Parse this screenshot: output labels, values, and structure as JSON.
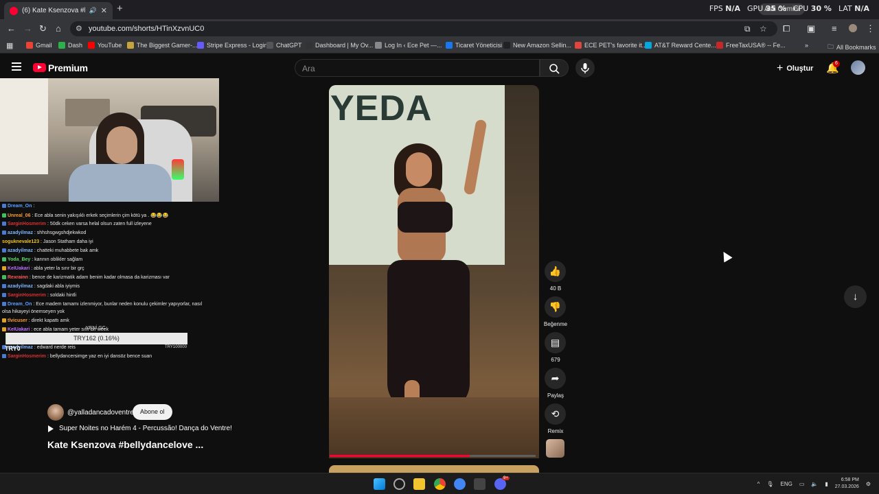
{
  "browser": {
    "tab_title": "(6) Kate Ksenzova #bellyda",
    "tab_audio_icon": "speaker-icon",
    "new_tab_glyph": "+",
    "gemini_label": "Ask Gemini",
    "url": "youtube.com/shorts/HTinXzvnUC0",
    "perf": {
      "fps_label": "FPS",
      "fps_value": "N/A",
      "gpu_label": "GPU",
      "gpu_value": "35 %",
      "cpu_label": "CPU",
      "cpu_value": "30 %",
      "lat_label": "LAT",
      "lat_value": "N/A"
    },
    "bookmarks": [
      {
        "label": "Gmail",
        "icon": "gmail-icon",
        "color": "#ea4335"
      },
      {
        "label": "Dash",
        "icon": "dash-icon",
        "color": "#2bb34a"
      },
      {
        "label": "YouTube",
        "icon": "youtube-icon",
        "color": "#ff0000"
      },
      {
        "label": "The Biggest Gamer-...",
        "icon": "gamer-icon",
        "color": "#c8a33b"
      },
      {
        "label": "Stripe Express - Login",
        "icon": "stripe-icon",
        "color": "#635bff"
      },
      {
        "label": "ChatGPT",
        "icon": "chatgpt-icon",
        "color": "#555555"
      },
      {
        "label": "Dashboard | My Ov...",
        "icon": "dashboard-icon",
        "color": "#333333"
      },
      {
        "label": "Log In ‹ Ece Pet —...",
        "icon": "wordpress-icon",
        "color": "#888888"
      },
      {
        "label": "Ticaret Yöneticisi",
        "icon": "meta-icon",
        "color": "#1877f2"
      },
      {
        "label": "New Amazon Sellin...",
        "icon": "amazon-icon",
        "color": "#222222"
      },
      {
        "label": "ECE PET's favorite it...",
        "icon": "shop-icon",
        "color": "#e0463c"
      },
      {
        "label": "AT&T Reward Cente...",
        "icon": "att-icon",
        "color": "#00a8e0"
      },
      {
        "label": "FreeTaxUSA® -- Fe...",
        "icon": "tax-icon",
        "color": "#c62828"
      }
    ],
    "all_bookmarks": "All Bookmarks"
  },
  "youtube": {
    "brand": "Premium",
    "search_placeholder": "Ara",
    "create_label": "Oluştur",
    "notification_count": "6"
  },
  "chat": [
    {
      "user": "Dream_On",
      "user_color": "#5aa0ff",
      "text": ":",
      "badge": "#4a7bd0"
    },
    {
      "user": "Unreal_06",
      "user_color": "#ff9e2c",
      "text": ": Ece abla senin yakışıklı erkek seçimlerin çim kötü ya . 😂😂😂",
      "badge": "#3cc060"
    },
    {
      "user": "SarginHosmerim",
      "user_color": "#d93030",
      "text": ": 50dk ceken varsa helal olsun zaten full izleyene",
      "badge": "#4a7bd0"
    },
    {
      "user": "azadyilmaz",
      "user_color": "#7db6ff",
      "text": ": shhshsgwgshdjekwkod",
      "badge": "#4a7bd0"
    },
    {
      "user": "soguknevale123",
      "user_color": "#f1c40f",
      "text": ": Jason Statham daha iyi",
      "badge": ""
    },
    {
      "user": "azadyilmaz",
      "user_color": "#7db6ff",
      "text": ": chatteki muhabbete bak amk",
      "badge": "#4a7bd0"
    },
    {
      "user": "Yoda_Bey",
      "user_color": "#55d96b",
      "text": ": karının oblikler sağlam",
      "badge": "#3cc060"
    },
    {
      "user": "KeIUakari",
      "user_color": "#c070ff",
      "text": ": abla yeter la sırır bir grç",
      "badge": "#e0a020"
    },
    {
      "user": "Rexrainn",
      "user_color": "#ff5a5a",
      "text": ": bence de karizmatik adam benim kadar olmasa da karizması var",
      "badge": "#3cc060"
    },
    {
      "user": "azadyilmaz",
      "user_color": "#7db6ff",
      "text": ": sagdaki abla iyiymis",
      "badge": "#4a7bd0"
    },
    {
      "user": "SarginHosmerim",
      "user_color": "#d93030",
      "text": ": soldaki hintli",
      "badge": "#4a7bd0"
    },
    {
      "user": "Dream_On",
      "user_color": "#5aa0ff",
      "text": ": Ece madem tamamı izlenmiyor, bunlar neden konulu çekimler yapıyorlar, nasıl",
      "badge": "#4a7bd0"
    },
    {
      "user": "",
      "user_color": "#e8e8e8",
      "text": "olsa hikayeyi önemseyen yok",
      "badge": ""
    },
    {
      "user": "tlvicuser",
      "user_color": "#ff9e2c",
      "text": ": direkt kapattı amk",
      "badge": "#e0a020"
    },
    {
      "user": "KeIUakari",
      "user_color": "#c070ff",
      "text": ": ece abla tamam yeter sıfır bir week",
      "badge": "#e0a020"
    },
    {
      "user": "azadyilmaz",
      "user_color": "#7db6ff",
      "text": ": edward nerde reis",
      "badge": "#4a7bd0"
    },
    {
      "user": "SarginHosmerim",
      "user_color": "#d93030",
      "text": ": bellydancersimge yaz en iyi dansöz bence suan",
      "badge": "#4a7bd0"
    }
  ],
  "donation": {
    "header": "YENİ GC",
    "bar_text": "TRY162 (0.16%)",
    "left": "TRY0",
    "right": "TRY100000",
    "progress": 0.16
  },
  "short": {
    "banner_text": "YEDA",
    "channel": "@yalladancadoventre",
    "subscribe_label": "Abone ol",
    "song": "Super Noites no Harém 4 - Percussão! Dança do Ventre!",
    "title": "Kate Ksenzova #bellydancelove ...",
    "playback_progress": 0.68
  },
  "actions": {
    "like_count": "40 B",
    "dislike_label": "Beğenme",
    "comment_count": "679",
    "share_label": "Paylaş",
    "remix_label": "Remix"
  },
  "taskbar": {
    "language": "ENG",
    "time": "6:58 PM",
    "date": "27.03.2026",
    "discord_badge": "9+"
  }
}
